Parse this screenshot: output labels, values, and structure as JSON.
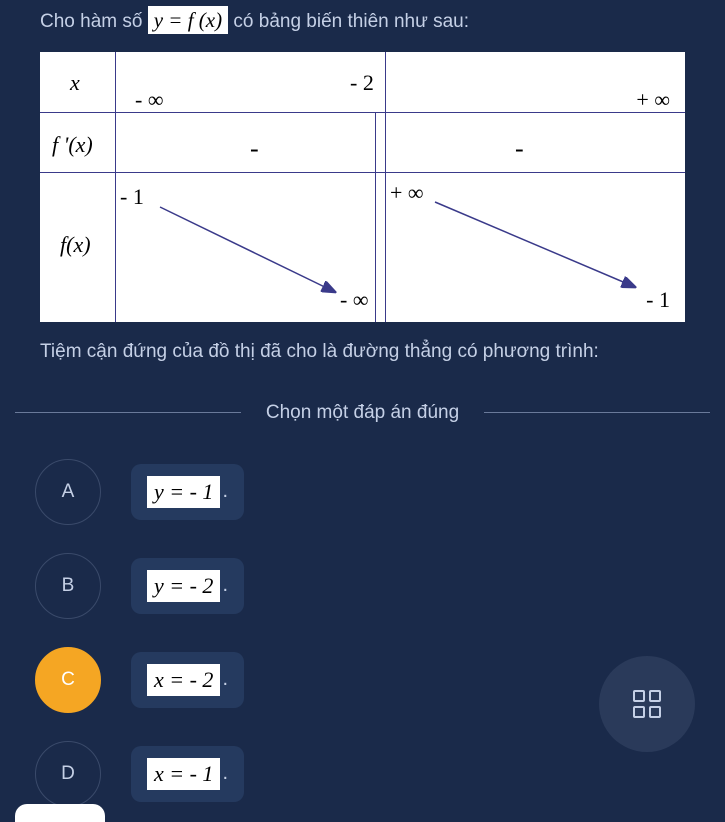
{
  "question": {
    "prefix": "Cho hàm số ",
    "formula": "y = f (x)",
    "suffix": " có bảng biến thiên như sau:",
    "after": "Tiệm cận đứng của đồ thị đã cho là đường thẳng có phương trình:"
  },
  "variation_table": {
    "row_x": {
      "label": "x",
      "values": [
        "- ∞",
        "- 2",
        "+ ∞"
      ]
    },
    "row_fprime": {
      "label": "f '(x)",
      "signs": [
        "-",
        "-"
      ]
    },
    "row_fx": {
      "label": "f(x)",
      "top_left": "- 1",
      "bottom_mid": "- ∞",
      "top_mid": "+ ∞",
      "bottom_right": "- 1"
    }
  },
  "divider": "Chọn một đáp án đúng",
  "options": {
    "a": {
      "letter": "A",
      "formula": "y = - 1"
    },
    "b": {
      "letter": "B",
      "formula": "y = - 2"
    },
    "c": {
      "letter": "C",
      "formula": "x = - 2",
      "selected": true
    },
    "d": {
      "letter": "D",
      "formula": "x = - 1"
    }
  }
}
